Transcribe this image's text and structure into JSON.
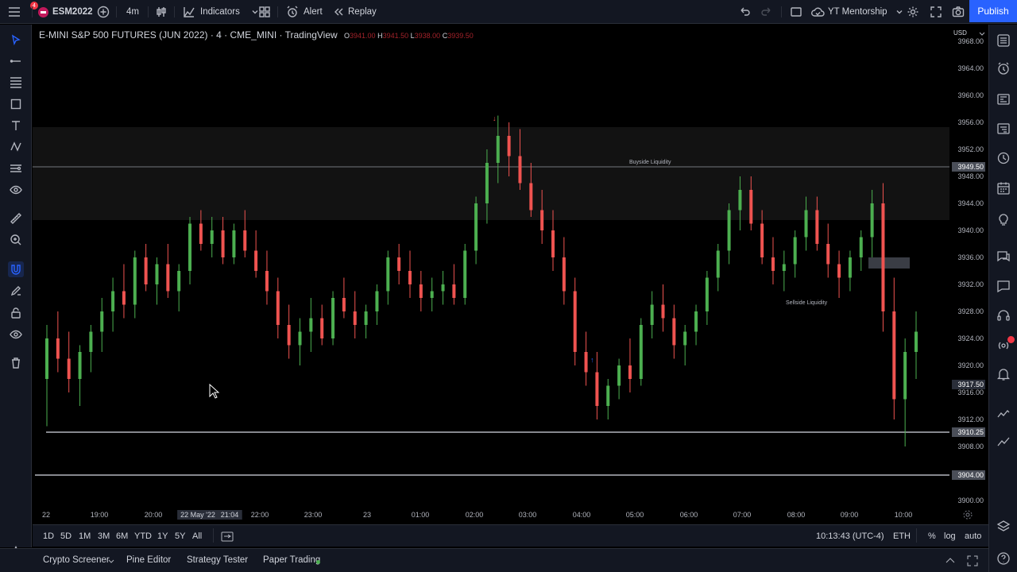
{
  "topbar": {
    "notifications": "4",
    "symbol": "ESM2022",
    "interval": "4m",
    "indicators": "Indicators",
    "alert": "Alert",
    "replay": "Replay",
    "layout_name": "YT Mentorship",
    "publish": "Publish"
  },
  "legend": {
    "title": "E-MINI S&P 500 FUTURES (JUN 2022) · 4 · CME_MINI · TradingView",
    "o_label": "O",
    "o": "3941.00",
    "h_label": "H",
    "h": "3941.50",
    "l_label": "L",
    "l": "3938.00",
    "c_label": "C",
    "c": "3939.50"
  },
  "annotations": {
    "buyside": "Buyside Liquidity",
    "sellside": "Sellside Liquidity"
  },
  "price_axis": {
    "currency": "USD",
    "labels": [
      "3968.00",
      "3964.00",
      "3960.00",
      "3956.00",
      "3952.00",
      "3948.00",
      "3944.00",
      "3940.00",
      "3936.00",
      "3932.00",
      "3928.00",
      "3924.00",
      "3920.00",
      "3916.00",
      "3912.00",
      "3908.00",
      "3900.00"
    ],
    "tag_buyside": "3949.50",
    "tag_current": "3917.50",
    "tag_low1": "3910.25",
    "tag_low2": "3904.00"
  },
  "time_axis": {
    "labels": [
      "22",
      "19:00",
      "20:00",
      "22 May '22",
      "21:04",
      "22:00",
      "23:00",
      "23",
      "01:00",
      "02:00",
      "03:00",
      "04:00",
      "05:00",
      "06:00",
      "07:00",
      "08:00",
      "09:00",
      "10:00"
    ]
  },
  "range_bar": {
    "ranges": [
      "1D",
      "5D",
      "1M",
      "3M",
      "6M",
      "YTD",
      "1Y",
      "5Y",
      "All"
    ],
    "clock": "10:13:43 (UTC-4)",
    "session": "ETH",
    "pct": "%",
    "log": "log",
    "auto": "auto"
  },
  "bottom_tabs": {
    "crypto": "Crypto Screener",
    "pine": "Pine Editor",
    "strategy": "Strategy Tester",
    "paper": "Paper Trading"
  },
  "colors": {
    "up": "#26a69a",
    "up_bright": "#4caf50",
    "down": "#ef5350",
    "accent": "#2962ff",
    "zone": "#1a1a1a"
  },
  "chart_data": {
    "type": "candlestick",
    "ylim": [
      3898,
      3969
    ],
    "candles": [
      [
        3918,
        3926,
        3911,
        3924
      ],
      [
        3924,
        3928,
        3919,
        3921
      ],
      [
        3921,
        3925,
        3916,
        3918
      ],
      [
        3918,
        3923,
        3914,
        3922
      ],
      [
        3922,
        3926,
        3919,
        3925
      ],
      [
        3925,
        3930,
        3922,
        3928
      ],
      [
        3928,
        3933,
        3925,
        3931
      ],
      [
        3931,
        3935,
        3927,
        3929
      ],
      [
        3929,
        3937,
        3927,
        3936
      ],
      [
        3936,
        3938,
        3931,
        3932
      ],
      [
        3932,
        3936,
        3929,
        3935
      ],
      [
        3935,
        3938,
        3930,
        3931
      ],
      [
        3931,
        3935,
        3928,
        3934
      ],
      [
        3934,
        3942,
        3932,
        3941
      ],
      [
        3941,
        3943,
        3937,
        3938
      ],
      [
        3938,
        3942,
        3936,
        3940
      ],
      [
        3940,
        3942,
        3935,
        3936
      ],
      [
        3936,
        3941,
        3935,
        3940
      ],
      [
        3940,
        3943,
        3936,
        3937
      ],
      [
        3937,
        3940,
        3933,
        3934
      ],
      [
        3934,
        3937,
        3929,
        3931
      ],
      [
        3931,
        3933,
        3924,
        3926
      ],
      [
        3926,
        3929,
        3921,
        3923
      ],
      [
        3923,
        3927,
        3920,
        3925
      ],
      [
        3925,
        3930,
        3922,
        3927
      ],
      [
        3927,
        3929,
        3923,
        3924
      ],
      [
        3924,
        3931,
        3923,
        3930
      ],
      [
        3930,
        3933,
        3927,
        3928
      ],
      [
        3928,
        3931,
        3924,
        3926
      ],
      [
        3926,
        3929,
        3924,
        3928
      ],
      [
        3928,
        3932,
        3926,
        3931
      ],
      [
        3931,
        3937,
        3929,
        3936
      ],
      [
        3936,
        3938,
        3932,
        3934
      ],
      [
        3934,
        3937,
        3930,
        3932
      ],
      [
        3932,
        3934,
        3928,
        3930
      ],
      [
        3930,
        3933,
        3928,
        3931
      ],
      [
        3931,
        3934,
        3929,
        3932
      ],
      [
        3932,
        3935,
        3929,
        3930
      ],
      [
        3930,
        3938,
        3929,
        3937
      ],
      [
        3937,
        3945,
        3935,
        3944
      ],
      [
        3944,
        3952,
        3941,
        3950
      ],
      [
        3950,
        3957,
        3947,
        3954
      ],
      [
        3954,
        3956,
        3948,
        3951
      ],
      [
        3951,
        3955,
        3946,
        3947
      ],
      [
        3947,
        3950,
        3942,
        3943
      ],
      [
        3943,
        3946,
        3938,
        3940
      ],
      [
        3940,
        3943,
        3934,
        3936
      ],
      [
        3936,
        3939,
        3929,
        3931
      ],
      [
        3931,
        3933,
        3920,
        3922
      ],
      [
        3922,
        3925,
        3917,
        3919
      ],
      [
        3919,
        3922,
        3912,
        3914
      ],
      [
        3914,
        3918,
        3912,
        3917
      ],
      [
        3917,
        3921,
        3915,
        3920
      ],
      [
        3920,
        3924,
        3916,
        3918
      ],
      [
        3918,
        3927,
        3917,
        3926
      ],
      [
        3926,
        3931,
        3924,
        3929
      ],
      [
        3929,
        3932,
        3925,
        3927
      ],
      [
        3927,
        3929,
        3921,
        3923
      ],
      [
        3923,
        3926,
        3920,
        3925
      ],
      [
        3925,
        3929,
        3923,
        3928
      ],
      [
        3928,
        3934,
        3926,
        3933
      ],
      [
        3933,
        3938,
        3931,
        3937
      ],
      [
        3937,
        3944,
        3935,
        3943
      ],
      [
        3943,
        3948,
        3940,
        3946
      ],
      [
        3946,
        3948,
        3940,
        3941
      ],
      [
        3941,
        3943,
        3935,
        3936
      ],
      [
        3936,
        3939,
        3932,
        3934
      ],
      [
        3934,
        3937,
        3931,
        3935
      ],
      [
        3935,
        3940,
        3933,
        3939
      ],
      [
        3939,
        3945,
        3937,
        3943
      ],
      [
        3943,
        3945,
        3937,
        3938
      ],
      [
        3938,
        3941,
        3933,
        3935
      ],
      [
        3935,
        3937,
        3930,
        3933
      ],
      [
        3933,
        3937,
        3931,
        3936
      ],
      [
        3936,
        3940,
        3934,
        3939
      ],
      [
        3939,
        3946,
        3936,
        3944
      ],
      [
        3944,
        3947,
        3925,
        3928
      ],
      [
        3928,
        3933,
        3912,
        3915
      ],
      [
        3915,
        3924,
        3908,
        3922
      ],
      [
        3922,
        3928,
        3918,
        3925
      ]
    ]
  }
}
